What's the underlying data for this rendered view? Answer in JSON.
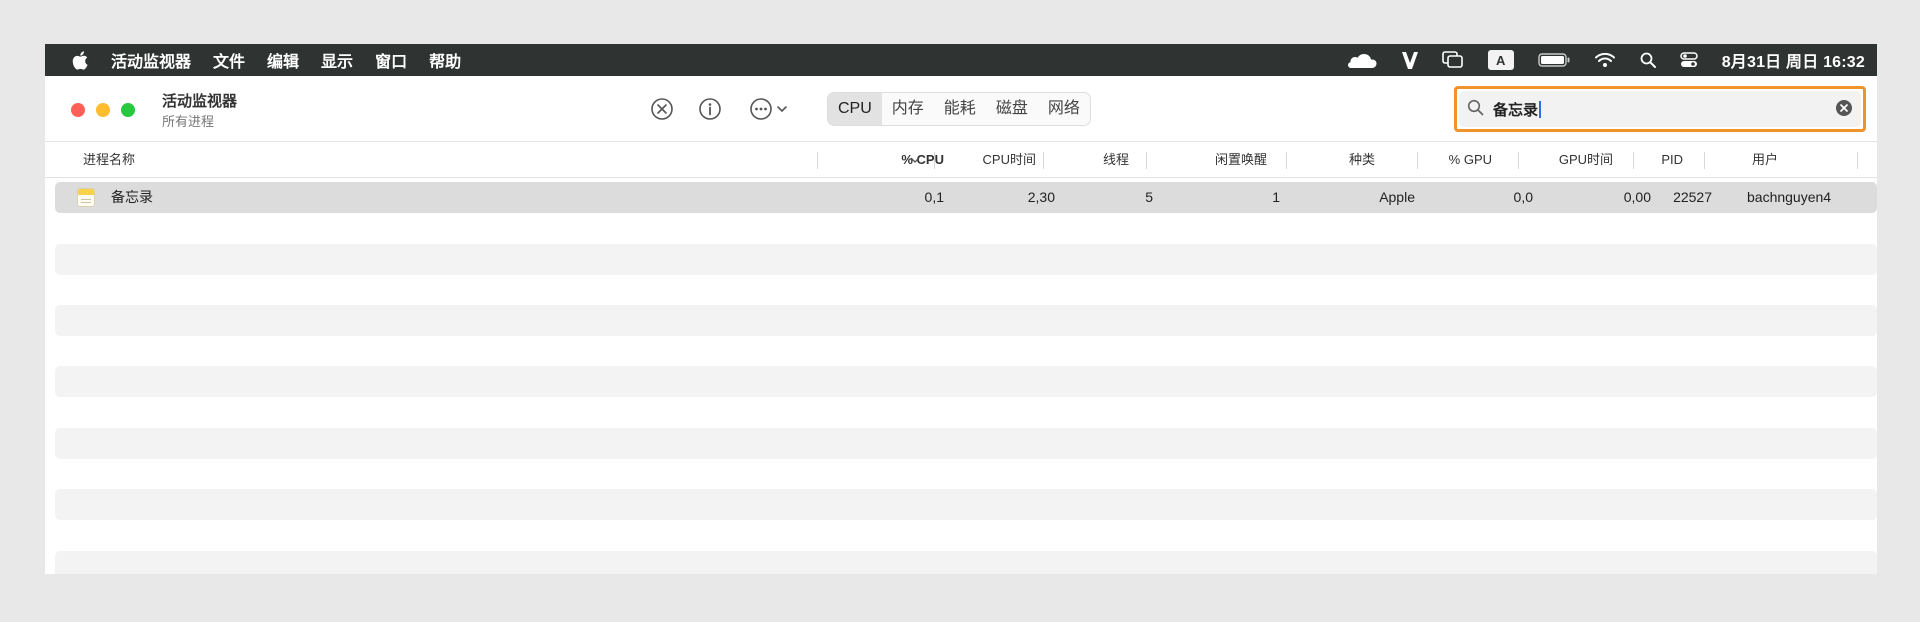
{
  "menubar": {
    "app_name": "活动监视器",
    "items": [
      "文件",
      "编辑",
      "显示",
      "窗口",
      "帮助"
    ],
    "input_badge": "A",
    "datetime": "8月31日 周日 16:32"
  },
  "window": {
    "title": "活动监视器",
    "subtitle": "所有进程"
  },
  "tabs": [
    {
      "label": "CPU",
      "active": true
    },
    {
      "label": "内存"
    },
    {
      "label": "能耗"
    },
    {
      "label": "磁盘"
    },
    {
      "label": "网络"
    }
  ],
  "search": {
    "value": "备忘录"
  },
  "columns": {
    "name": "进程名称",
    "cpu_pct": "% CPU",
    "cpu_time": "CPU时间",
    "threads": "线程",
    "idle_wake": "闲置唤醒",
    "kind": "种类",
    "gpu_pct": "% GPU",
    "gpu_time": "GPU时间",
    "pid": "PID",
    "user": "用户"
  },
  "processes": [
    {
      "name": "备忘录",
      "cpu_pct": "0,1",
      "cpu_time": "2,30",
      "threads": "5",
      "idle_wake": "1",
      "kind": "Apple",
      "gpu_pct": "0,0",
      "gpu_time": "0,00",
      "pid": "22527",
      "user": "bachnguyen4"
    }
  ],
  "colors": {
    "accent_search_border": "#f0932b",
    "menubar": "#2f3433"
  }
}
